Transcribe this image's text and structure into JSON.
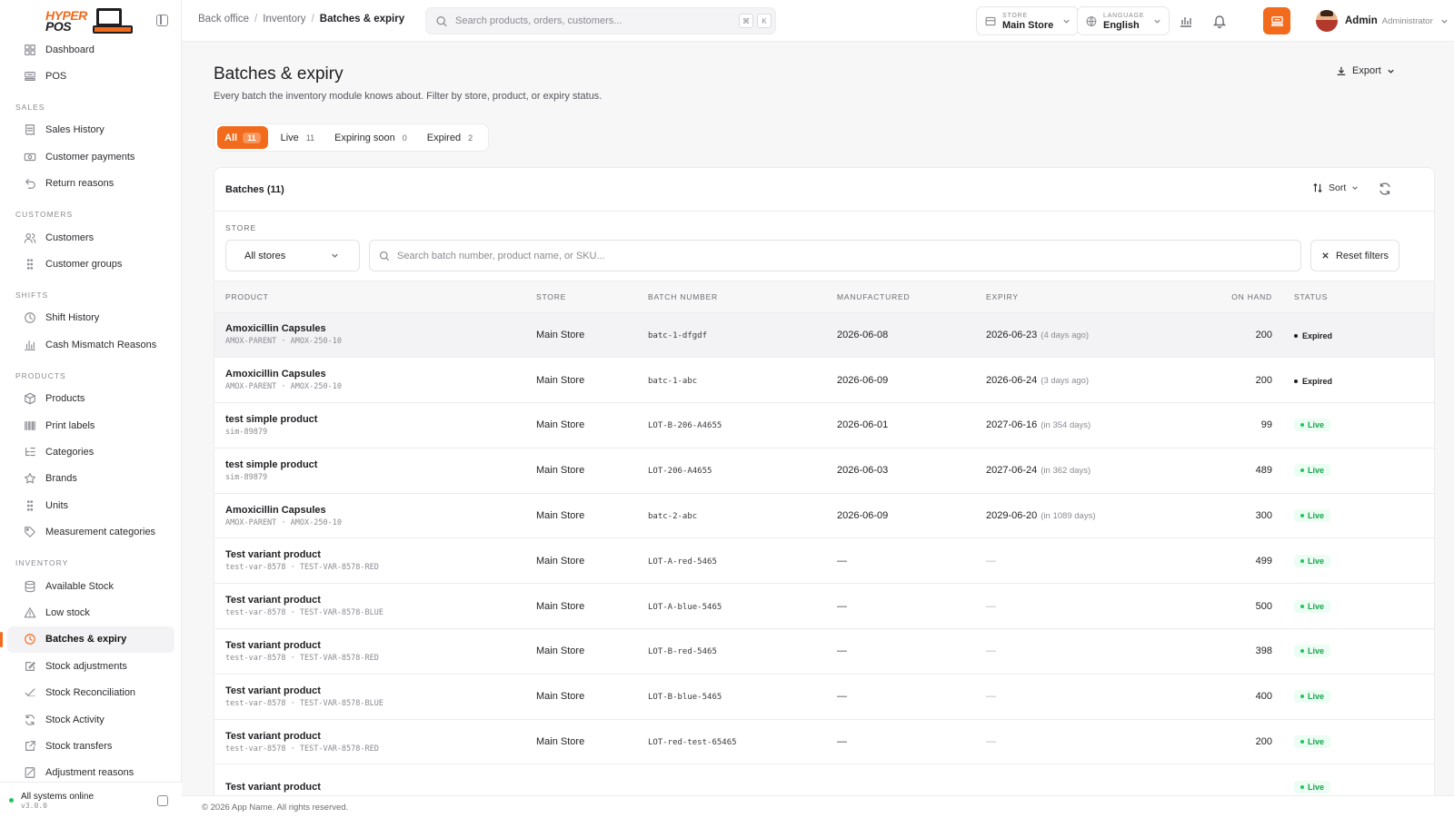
{
  "brand": {
    "line1": "HYPER",
    "line2": "POS"
  },
  "sidebar": {
    "top_items": [
      {
        "label": "Dashboard",
        "icon": "grid-icon"
      },
      {
        "label": "POS",
        "icon": "register-icon"
      }
    ],
    "sections": [
      {
        "title": "SALES",
        "items": [
          {
            "label": "Sales History",
            "icon": "receipt-icon"
          },
          {
            "label": "Customer payments",
            "icon": "cash-icon"
          },
          {
            "label": "Return reasons",
            "icon": "undo-icon"
          }
        ]
      },
      {
        "title": "CUSTOMERS",
        "items": [
          {
            "label": "Customers",
            "icon": "users-icon"
          },
          {
            "label": "Customer groups",
            "icon": "dots-grid-icon"
          }
        ]
      },
      {
        "title": "SHIFTS",
        "items": [
          {
            "label": "Shift History",
            "icon": "clock-icon"
          },
          {
            "label": "Cash Mismatch Reasons",
            "icon": "bar-chart-icon"
          }
        ]
      },
      {
        "title": "PRODUCTS",
        "items": [
          {
            "label": "Products",
            "icon": "box-icon"
          },
          {
            "label": "Print labels",
            "icon": "barcode-icon"
          },
          {
            "label": "Categories",
            "icon": "list-tree-icon"
          },
          {
            "label": "Brands",
            "icon": "star-icon"
          },
          {
            "label": "Units",
            "icon": "dots-grid-icon"
          },
          {
            "label": "Measurement categories",
            "icon": "tag-icon"
          }
        ]
      },
      {
        "title": "INVENTORY",
        "items": [
          {
            "label": "Available Stock",
            "icon": "database-icon"
          },
          {
            "label": "Low stock",
            "icon": "warning-icon"
          },
          {
            "label": "Batches & expiry",
            "icon": "clock-icon",
            "active": true
          },
          {
            "label": "Stock adjustments",
            "icon": "edit-icon"
          },
          {
            "label": "Stock Reconciliation",
            "icon": "check-icon"
          },
          {
            "label": "Stock Activity",
            "icon": "refresh-icon"
          },
          {
            "label": "Stock transfers",
            "icon": "external-icon"
          },
          {
            "label": "Adjustment reasons",
            "icon": "note-icon"
          }
        ]
      }
    ],
    "status": {
      "label": "All systems online",
      "version": "v3.0.0"
    }
  },
  "topbar": {
    "breadcrumbs": [
      "Back office",
      "Inventory",
      "Batches & expiry"
    ],
    "search_placeholder": "Search products, orders, customers...",
    "kbd1": "⌘",
    "kbd2": "K",
    "store": {
      "label": "STORE",
      "value": "Main Store"
    },
    "language": {
      "label": "LANGUAGE",
      "value": "English"
    },
    "user": {
      "name": "Admin",
      "role": "Administrator"
    }
  },
  "page": {
    "title": "Batches & expiry",
    "subtitle": "Every batch the inventory module knows about. Filter by store, product, or expiry status.",
    "export_label": "Export"
  },
  "tabs": [
    {
      "label": "All",
      "count": "11",
      "active": true
    },
    {
      "label": "Live",
      "count": "11"
    },
    {
      "label": "Expiring soon",
      "count": "0"
    },
    {
      "label": "Expired",
      "count": "2"
    }
  ],
  "card": {
    "title": "Batches (11)",
    "sort_label": "Sort",
    "store_filter_label": "STORE",
    "store_filter_value": "All stores",
    "search_placeholder": "Search batch number, product name, or SKU...",
    "reset_label": "Reset filters"
  },
  "table": {
    "columns": [
      "PRODUCT",
      "STORE",
      "BATCH NUMBER",
      "MANUFACTURED",
      "EXPIRY",
      "ON HAND",
      "STATUS"
    ],
    "rows": [
      {
        "product": "Amoxicillin Capsules",
        "sku": "AMOX-PARENT · AMOX-250-10",
        "store": "Main Store",
        "batch": "batc-1-dfgdf",
        "manufactured": "2026-06-08",
        "expiry": "2026-06-23",
        "expiry_rel": "(4 days ago)",
        "on_hand": "200",
        "status": "Expired"
      },
      {
        "product": "Amoxicillin Capsules",
        "sku": "AMOX-PARENT · AMOX-250-10",
        "store": "Main Store",
        "batch": "batc-1-abc",
        "manufactured": "2026-06-09",
        "expiry": "2026-06-24",
        "expiry_rel": "(3 days ago)",
        "on_hand": "200",
        "status": "Expired"
      },
      {
        "product": "test simple product",
        "sku": "sim-89879",
        "store": "Main Store",
        "batch": "LOT-B-206-A4655",
        "manufactured": "2026-06-01",
        "expiry": "2027-06-16",
        "expiry_rel": "(in 354 days)",
        "on_hand": "99",
        "status": "Live"
      },
      {
        "product": "test simple product",
        "sku": "sim-89879",
        "store": "Main Store",
        "batch": "LOT-206-A4655",
        "manufactured": "2026-06-03",
        "expiry": "2027-06-24",
        "expiry_rel": "(in 362 days)",
        "on_hand": "489",
        "status": "Live"
      },
      {
        "product": "Amoxicillin Capsules",
        "sku": "AMOX-PARENT · AMOX-250-10",
        "store": "Main Store",
        "batch": "batc-2-abc",
        "manufactured": "2026-06-09",
        "expiry": "2029-06-20",
        "expiry_rel": "(in 1089 days)",
        "on_hand": "300",
        "status": "Live"
      },
      {
        "product": "Test variant product",
        "sku": "test-var-8578 · TEST-VAR-8578-RED",
        "store": "Main Store",
        "batch": "LOT-A-red-5465",
        "manufactured": "—",
        "expiry": "—",
        "expiry_rel": "",
        "on_hand": "499",
        "status": "Live"
      },
      {
        "product": "Test variant product",
        "sku": "test-var-8578 · TEST-VAR-8578-BLUE",
        "store": "Main Store",
        "batch": "LOT-A-blue-5465",
        "manufactured": "—",
        "expiry": "—",
        "expiry_rel": "",
        "on_hand": "500",
        "status": "Live"
      },
      {
        "product": "Test variant product",
        "sku": "test-var-8578 · TEST-VAR-8578-RED",
        "store": "Main Store",
        "batch": "LOT-B-red-5465",
        "manufactured": "—",
        "expiry": "—",
        "expiry_rel": "",
        "on_hand": "398",
        "status": "Live"
      },
      {
        "product": "Test variant product",
        "sku": "test-var-8578 · TEST-VAR-8578-BLUE",
        "store": "Main Store",
        "batch": "LOT-B-blue-5465",
        "manufactured": "—",
        "expiry": "—",
        "expiry_rel": "",
        "on_hand": "400",
        "status": "Live"
      },
      {
        "product": "Test variant product",
        "sku": "test-var-8578 · TEST-VAR-8578-RED",
        "store": "Main Store",
        "batch": "LOT-red-test-65465",
        "manufactured": "—",
        "expiry": "—",
        "expiry_rel": "",
        "on_hand": "200",
        "status": "Live"
      },
      {
        "product": "Test variant product",
        "sku": "",
        "store": "",
        "batch": "",
        "manufactured": "",
        "expiry": "",
        "expiry_rel": "",
        "on_hand": "",
        "status": "Live"
      }
    ]
  },
  "footer": {
    "text": "© 2026 App Name. All rights reserved."
  },
  "colors": {
    "accent": "#f26a1b",
    "live": "#16a34a",
    "live_bg": "#ecfdf3"
  }
}
